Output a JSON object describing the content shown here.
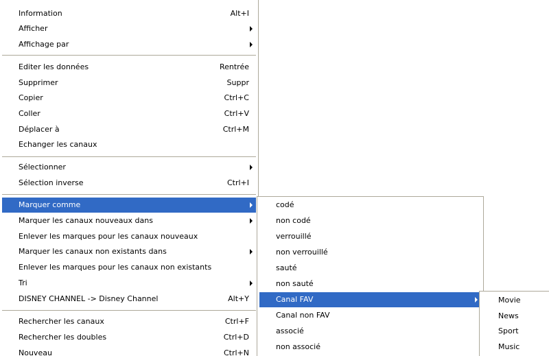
{
  "main_menu": {
    "items": [
      {
        "label": "Information",
        "shortcut": "Alt+I"
      },
      {
        "label": "Afficher",
        "shortcut": ""
      },
      {
        "label": "Affichage par",
        "shortcut": ""
      },
      {
        "label": "Editer les données",
        "shortcut": "Rentrée"
      },
      {
        "label": "Supprimer",
        "shortcut": "Suppr"
      },
      {
        "label": "Copier",
        "shortcut": "Ctrl+C"
      },
      {
        "label": "Coller",
        "shortcut": "Ctrl+V"
      },
      {
        "label": "Déplacer à",
        "shortcut": "Ctrl+M"
      },
      {
        "label": "Echanger les canaux",
        "shortcut": ""
      },
      {
        "label": "Sélectionner",
        "shortcut": ""
      },
      {
        "label": "Sélection inverse",
        "shortcut": "Ctrl+I"
      },
      {
        "label": "Marquer comme",
        "shortcut": ""
      },
      {
        "label": "Marquer les canaux nouveaux dans",
        "shortcut": ""
      },
      {
        "label": "Enlever les marques pour les canaux nouveaux",
        "shortcut": ""
      },
      {
        "label": "Marquer les canaux non existants dans",
        "shortcut": ""
      },
      {
        "label": "Enlever les marques pour les canaux non existants",
        "shortcut": ""
      },
      {
        "label": "Tri",
        "shortcut": ""
      },
      {
        "label": "DISNEY CHANNEL -> Disney Channel",
        "shortcut": "Alt+Y"
      },
      {
        "label": "Rechercher les canaux",
        "shortcut": "Ctrl+F"
      },
      {
        "label": "Rechercher les doubles",
        "shortcut": "Ctrl+D"
      },
      {
        "label": "Nouveau",
        "shortcut": "Ctrl+N"
      }
    ]
  },
  "submenu_marquer": {
    "items": [
      {
        "label": "codé"
      },
      {
        "label": "non codé"
      },
      {
        "label": "verrouillé"
      },
      {
        "label": "non verrouillé"
      },
      {
        "label": "sauté"
      },
      {
        "label": "non sauté"
      },
      {
        "label": "Canal FAV"
      },
      {
        "label": "Canal non FAV"
      },
      {
        "label": "associé"
      },
      {
        "label": "non associé"
      }
    ]
  },
  "submenu_fav": {
    "items": [
      {
        "label": "Movie"
      },
      {
        "label": "News"
      },
      {
        "label": "Sport"
      },
      {
        "label": "Music"
      }
    ]
  },
  "colors": {
    "highlight": "#316ac5",
    "border": "#aca899"
  }
}
